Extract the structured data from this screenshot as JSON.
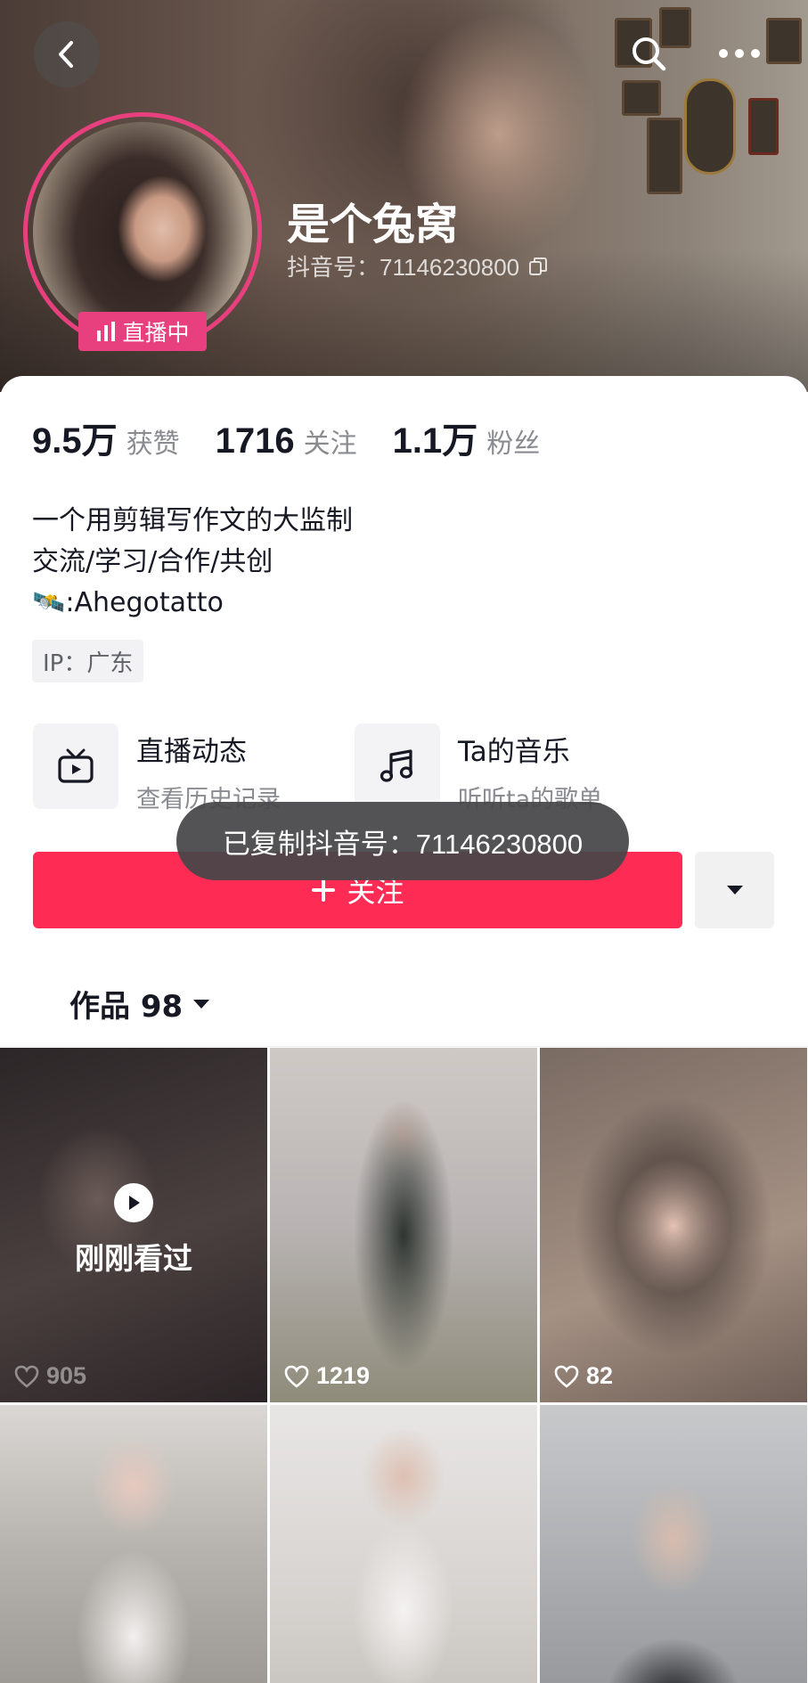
{
  "header": {
    "nickname": "是个兔窝",
    "account_id_text": "抖音号：71146230800",
    "live_badge": "直播中"
  },
  "stats": {
    "likes_value": "9.5万",
    "likes_label": "获赞",
    "following_value": "1716",
    "following_label": "关注",
    "followers_value": "1.1万",
    "followers_label": "粉丝"
  },
  "bio": {
    "line1": "一个用剪辑写作文的大监制",
    "line2": "交流/学习/合作/共创",
    "line3": ":Ahegotatto",
    "line3_emoji": "🛰️"
  },
  "ip": "IP：广东",
  "features": [
    {
      "title": "直播动态",
      "subtitle": "查看历史记录",
      "icon": "tv-icon"
    },
    {
      "title": "Ta的音乐",
      "subtitle": "听听ta的歌单",
      "icon": "music-note-icon"
    }
  ],
  "follow_button": "关注",
  "toast": "已复制抖音号：71146230800",
  "tab": {
    "label": "作品 98"
  },
  "videos": [
    {
      "likes": "905",
      "watched_label": "刚刚看过"
    },
    {
      "likes": "1219"
    },
    {
      "likes": "82"
    },
    {
      "likes": ""
    },
    {
      "likes": ""
    },
    {
      "likes": ""
    }
  ],
  "colors": {
    "primary": "#fe2c55",
    "live_pink": "#e8407e",
    "text": "#161823",
    "muted": "#8a8b91"
  }
}
